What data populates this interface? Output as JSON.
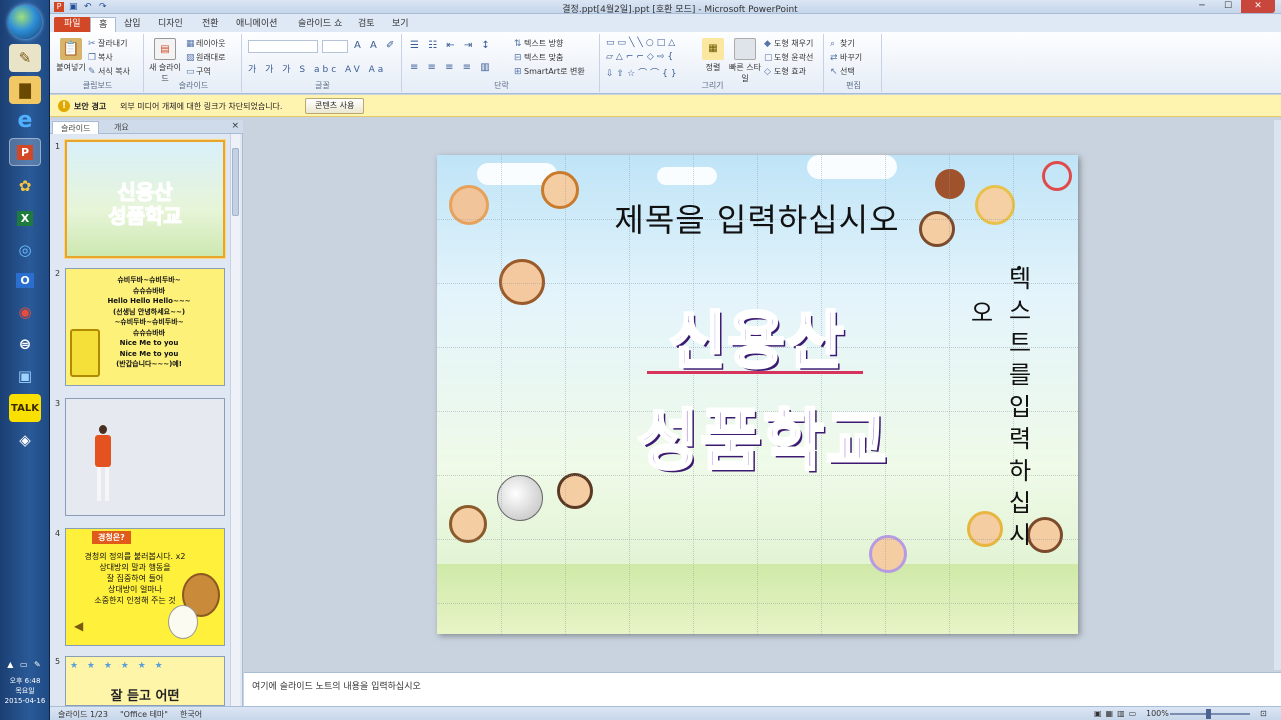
{
  "taskbar": {
    "icons": [
      "start-orb",
      "pen-icon",
      "folder-icon",
      "ie-icon",
      "powerpoint-icon",
      "app-icon",
      "excel-icon",
      "ie-icon",
      "outlook-icon",
      "chrome-icon",
      "app-icon",
      "app-icon",
      "kakaotalk-icon",
      "app-icon"
    ],
    "clock": {
      "time": "오후 6:48",
      "day": "목요일",
      "date": "2015-04-16"
    }
  },
  "window": {
    "title": "결정.ppt[4월2일].ppt [호환 모드] - Microsoft PowerPoint"
  },
  "tabs": [
    "파일",
    "홈",
    "삽입",
    "디자인",
    "전환",
    "애니메이션",
    "슬라이드 쇼",
    "검토",
    "보기"
  ],
  "active_tab": "홈",
  "ribbon": {
    "clipboard": {
      "paste": "붙여넣기",
      "cut": "잘라내기",
      "copy": "복사",
      "format_painter": "서식 복사",
      "label": "클립보드"
    },
    "slides": {
      "new_slide": "새 슬라이드",
      "layout": "레이아웃",
      "reset": "원래대로",
      "section": "구역",
      "label": "슬라이드"
    },
    "font": {
      "label": "글꼴"
    },
    "paragraph": {
      "text_direction": "텍스트 방향",
      "align_text": "텍스트 맞춤",
      "smartart": "SmartArt로 변환",
      "label": "단락"
    },
    "drawing": {
      "arrange": "정렬",
      "quick_styles": "빠른 스타일",
      "shape_fill": "도형 채우기",
      "shape_outline": "도형 윤곽선",
      "shape_effects": "도형 효과",
      "label": "그리기"
    },
    "editing": {
      "find": "찾기",
      "replace": "바꾸기",
      "select": "선택",
      "label": "편집"
    }
  },
  "message_bar": {
    "title": "보안 경고",
    "text": "외부 미디어 개체에 대한 링크가 차단되었습니다.",
    "button": "콘텐츠 사용"
  },
  "panel": {
    "tabs": [
      "슬라이드",
      "개요"
    ],
    "close": "×"
  },
  "thumbnails": {
    "s1": {
      "num": "1",
      "line1": "신용산",
      "line2": "성품학교"
    },
    "s2": {
      "num": "2",
      "lines": "슈비두바~슈비두바~\n슈슈슈바바\nHello  Hello  Hello~~~\n(선생님 안녕하세요~~)\n~슈비두바~슈비두바~\n슈슈슈바바\nNice Me to you\nNice Me to you\n(반갑습니다~~~)예!"
    },
    "s3": {
      "num": "3"
    },
    "s4": {
      "num": "4",
      "title": "경청은?",
      "lines": "경청의 정의를 불러봅시다. x2\n상대방의 말과 행동을\n잘 집중하여 들어\n상대방이 얼마나\n소중한지 인정해 주는 것"
    },
    "s5": {
      "num": "5",
      "line": "잘 듣고 어떤"
    }
  },
  "slide": {
    "title_placeholder": "제목을 입력하십시오",
    "big_line1": "신용산",
    "big_line2": "성품학교",
    "vertical_text": [
      "텍",
      "스",
      "트",
      "를",
      "입",
      "력",
      "하",
      "십",
      "시"
    ],
    "vertical_o": "오",
    "bullet": "•"
  },
  "notes": {
    "placeholder": "여기에 슬라이드 노트의 내용을 입력하십시오"
  },
  "status": {
    "slide": "슬라이드 1/23",
    "theme": "\"Office 테마\"",
    "lang": "한국어",
    "zoom": "100%"
  }
}
